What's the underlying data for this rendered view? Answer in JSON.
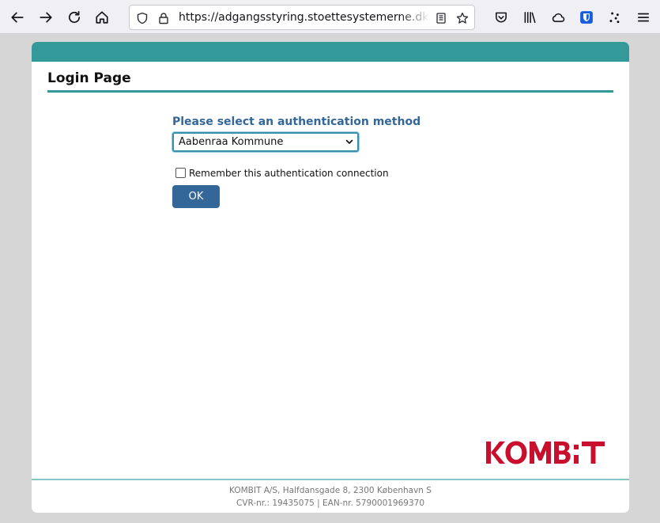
{
  "browser": {
    "url": "https://adgangsstyring.stoettesystemerne.dk/ru"
  },
  "page": {
    "title": "Login Page",
    "auth_heading": "Please select an authentication method",
    "auth_select": {
      "selected": "Aabenraa Kommune"
    },
    "remember_label": "Remember this authentication connection",
    "remember_checked": false,
    "ok_label": "OK",
    "logo_text": "KOMBIT",
    "footer": {
      "line1": "KOMBIT A/S, Halfdansgade 8, 2300 København S",
      "line2": "CVR-nr.: 19435075 | EAN-nr. 5790001969370"
    }
  },
  "colors": {
    "header_bar": "#339999",
    "heading": "#336699",
    "button": "#336699",
    "logo": "#c8102e"
  }
}
